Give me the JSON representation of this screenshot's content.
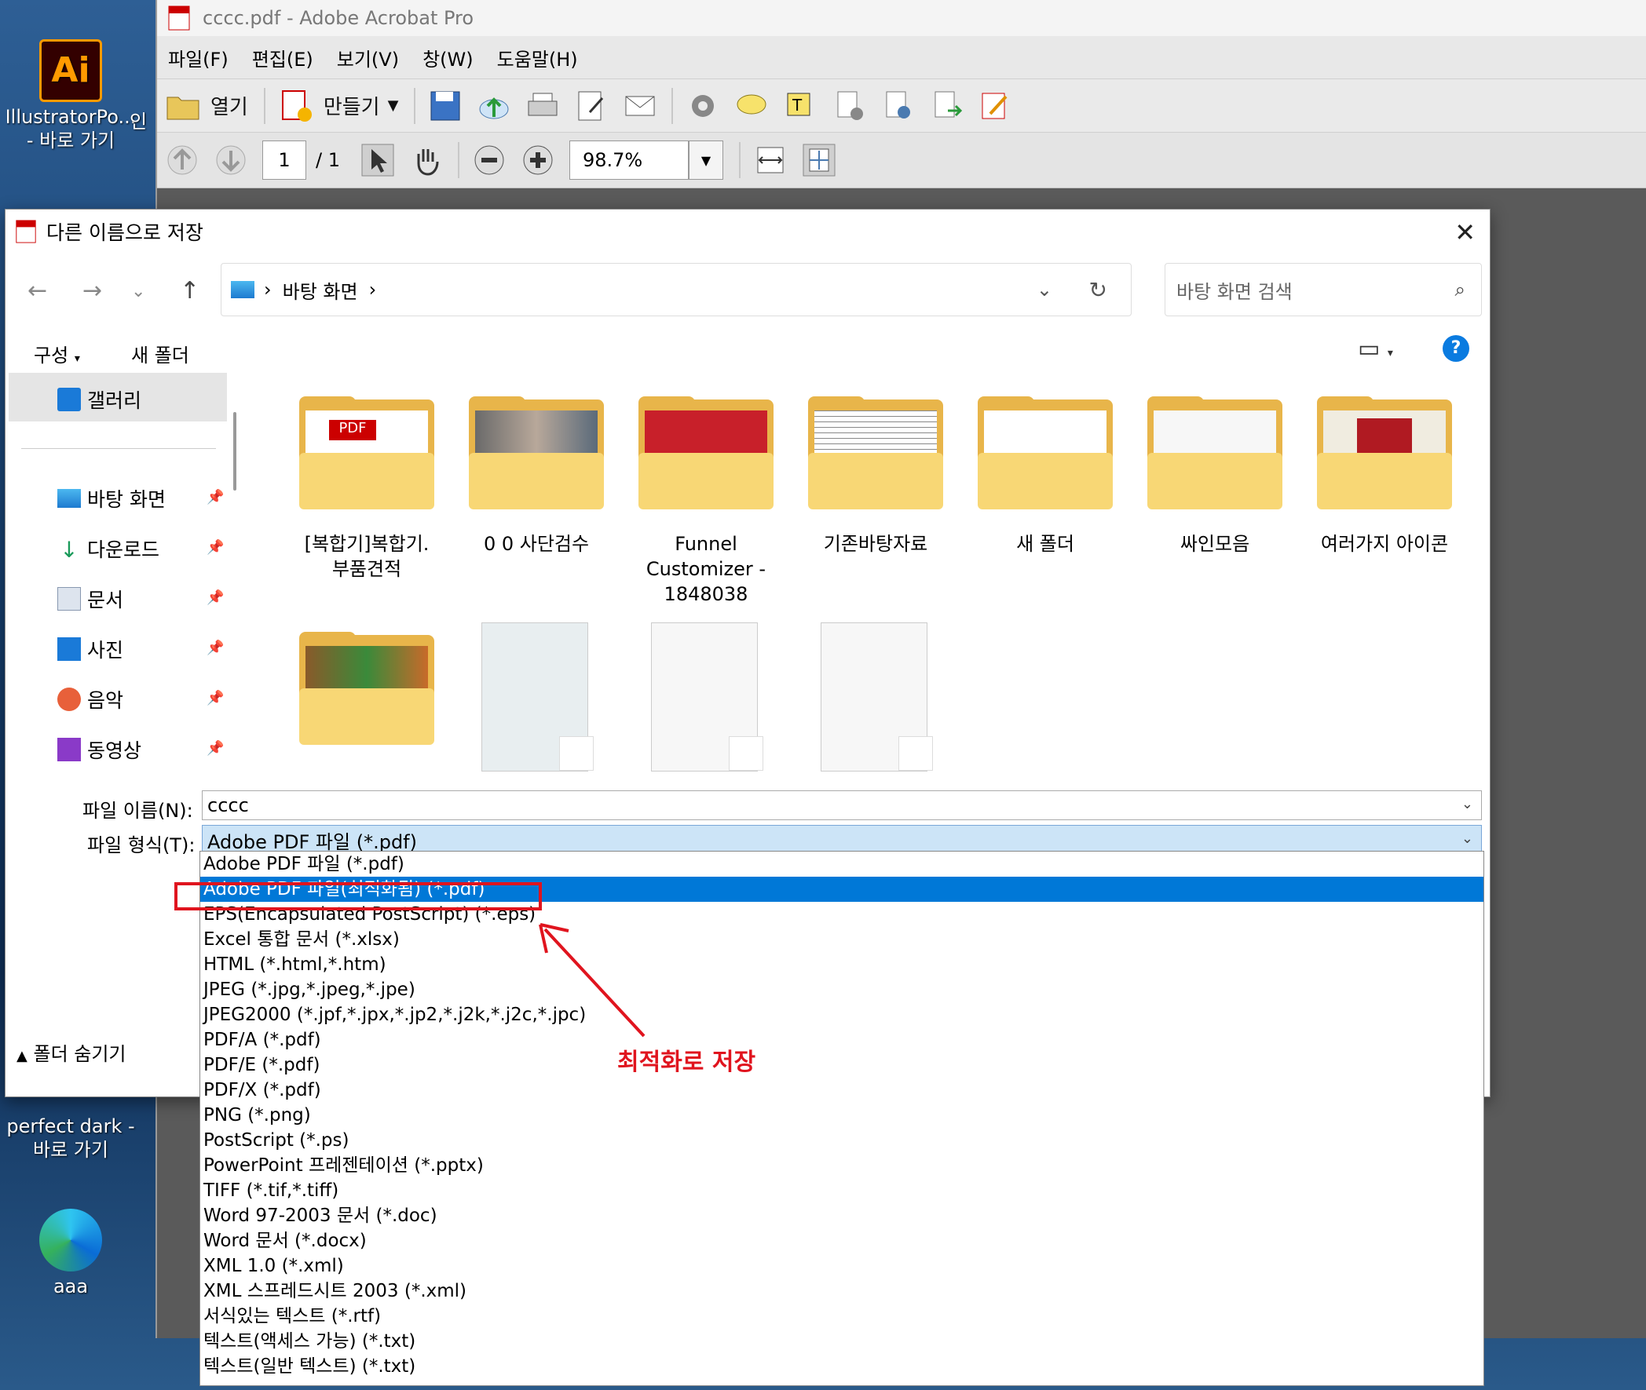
{
  "desktop": {
    "icons": [
      {
        "label": "IllustratorPo...",
        "label2": "- 바로 가기"
      },
      {
        "label": "perfect dark -",
        "label2": "바로 가기"
      },
      {
        "label": "aaa",
        "label2": ""
      }
    ],
    "partial_label": "인"
  },
  "acrobat": {
    "title": "cccc.pdf - Adobe Acrobat Pro",
    "menu": [
      "파일(F)",
      "편집(E)",
      "보기(V)",
      "창(W)",
      "도움말(H)"
    ],
    "open_label": "열기",
    "create_label": "만들기",
    "page_current": "1",
    "page_total": "/ 1",
    "zoom": "98.7%"
  },
  "dialog": {
    "title": "다른 이름으로 저장",
    "breadcrumb": "바탕 화면",
    "search_placeholder": "바탕 화면 검색",
    "organize": "구성",
    "new_folder": "새 폴더",
    "nav": [
      {
        "label": "갤러리"
      },
      {
        "label": "바탕 화면"
      },
      {
        "label": "다운로드"
      },
      {
        "label": "문서"
      },
      {
        "label": "사진"
      },
      {
        "label": "음악"
      },
      {
        "label": "동영상"
      }
    ],
    "folders": [
      {
        "l1": "[복합기]복합기.",
        "l2": "부품견적",
        "l3": ""
      },
      {
        "l1": "0 0 사단검수",
        "l2": "",
        "l3": ""
      },
      {
        "l1": "Funnel",
        "l2": "Customizer -",
        "l3": "1848038"
      },
      {
        "l1": "기존바탕자료",
        "l2": "",
        "l3": ""
      },
      {
        "l1": "새 폴더",
        "l2": "",
        "l3": ""
      },
      {
        "l1": "싸인모음",
        "l2": "",
        "l3": ""
      },
      {
        "l1": "여러가지 아이콘",
        "l2": "",
        "l3": ""
      }
    ],
    "filename_label": "파일 이름(N):",
    "filename_value": "cccc",
    "filetype_label": "파일 형식(T):",
    "filetype_value": "Adobe PDF 파일 (*.pdf)",
    "hide_folders": "폴더 숨기기"
  },
  "filetype_options": [
    "Adobe PDF 파일 (*.pdf)",
    "Adobe PDF 파일(최적화됨) (*.pdf)",
    "EPS(Encapsulated PostScript) (*.eps)",
    "Excel 통합 문서 (*.xlsx)",
    "HTML (*.html,*.htm)",
    "JPEG (*.jpg,*.jpeg,*.jpe)",
    "JPEG2000 (*.jpf,*.jpx,*.jp2,*.j2k,*.j2c,*.jpc)",
    "PDF/A (*.pdf)",
    "PDF/E (*.pdf)",
    "PDF/X (*.pdf)",
    "PNG (*.png)",
    "PostScript (*.ps)",
    "PowerPoint 프레젠테이션 (*.pptx)",
    "TIFF (*.tif,*.tiff)",
    "Word 97-2003 문서 (*.doc)",
    "Word 문서 (*.docx)",
    "XML 1.0 (*.xml)",
    "XML 스프레드시트 2003 (*.xml)",
    "서식있는 텍스트 (*.rtf)",
    "텍스트(액세스 가능) (*.txt)",
    "텍스트(일반 텍스트) (*.txt)"
  ],
  "selected_option_index": 1,
  "annotation": "최적화로 저장",
  "colors": {
    "highlight": "#0078d7",
    "annotation": "#e0141e",
    "folder": "#f8d775"
  }
}
